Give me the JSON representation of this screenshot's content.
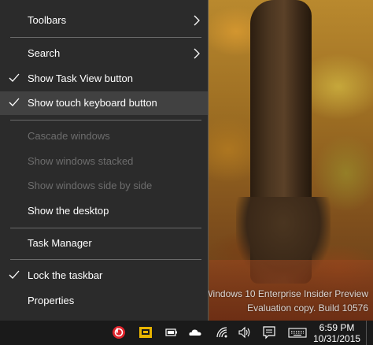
{
  "context_menu": {
    "items": [
      {
        "label": "Toolbars",
        "checked": false,
        "enabled": true,
        "submenu": true
      },
      {
        "label": "Search",
        "checked": false,
        "enabled": true,
        "submenu": true
      },
      {
        "label": "Show Task View button",
        "checked": true,
        "enabled": true,
        "submenu": false
      },
      {
        "label": "Show touch keyboard button",
        "checked": true,
        "enabled": true,
        "submenu": false,
        "hovered": true
      },
      {
        "label": "Cascade windows",
        "checked": false,
        "enabled": false,
        "submenu": false
      },
      {
        "label": "Show windows stacked",
        "checked": false,
        "enabled": false,
        "submenu": false
      },
      {
        "label": "Show windows side by side",
        "checked": false,
        "enabled": false,
        "submenu": false
      },
      {
        "label": "Show the desktop",
        "checked": false,
        "enabled": true,
        "submenu": false
      },
      {
        "label": "Task Manager",
        "checked": false,
        "enabled": true,
        "submenu": false
      },
      {
        "label": "Lock the taskbar",
        "checked": true,
        "enabled": true,
        "submenu": false
      },
      {
        "label": "Properties",
        "checked": false,
        "enabled": true,
        "submenu": false
      }
    ]
  },
  "watermark": {
    "line1": "Windows 10 Enterprise Insider Preview",
    "line2": "Evaluation copy. Build 10576"
  },
  "taskbar": {
    "tray_icons": [
      "beats-audio-icon",
      "media-icon",
      "battery-icon",
      "onedrive-icon",
      "wifi-icon",
      "volume-icon",
      "action-center-icon",
      "touch-keyboard-icon"
    ],
    "time": "6:59 PM",
    "date": "10/31/2015"
  },
  "colors": {
    "menu_bg": "#2b2b2b",
    "menu_hover": "#414141",
    "menu_text": "#ffffff",
    "menu_disabled_text": "#6d6d6d",
    "taskbar_bg": "#1a1a1a",
    "beats_red": "#e0242c",
    "media_yellow": "#e8b400"
  }
}
